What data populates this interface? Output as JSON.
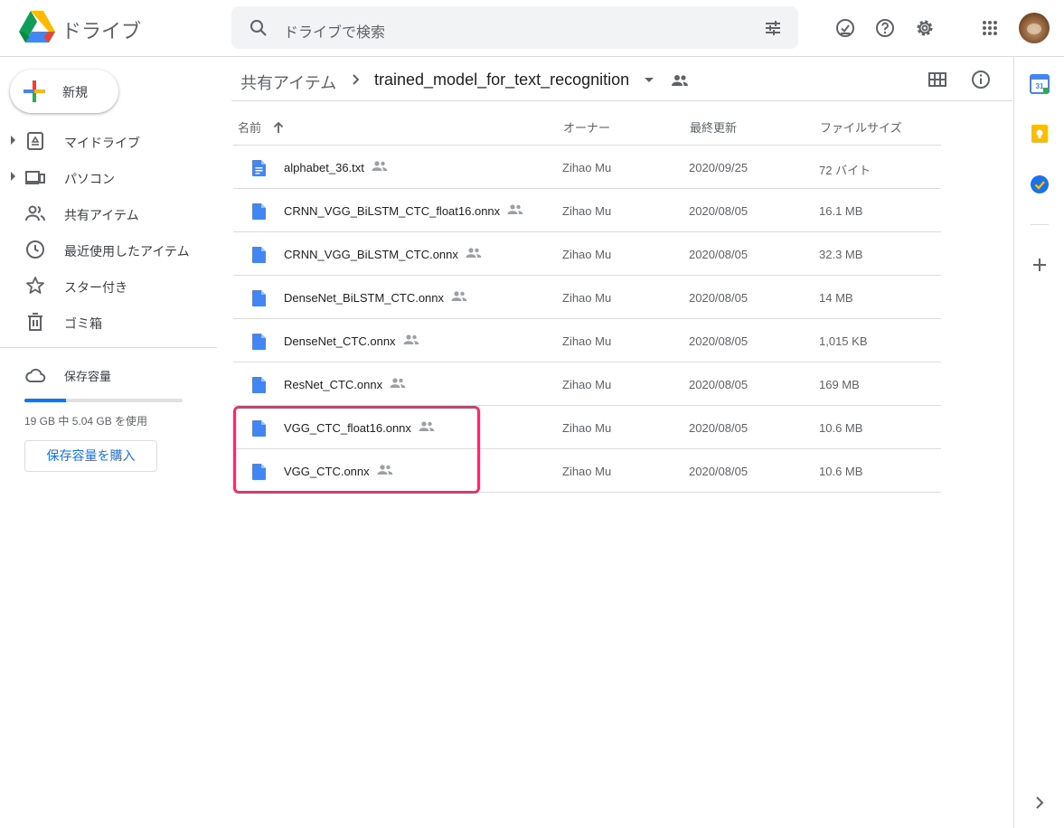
{
  "header": {
    "app_name": "ドライブ",
    "search_placeholder": "ドライブで検索"
  },
  "sidebar": {
    "new_label": "新規",
    "items": [
      {
        "label": "マイドライブ",
        "icon": "my-drive-icon",
        "expandable": true
      },
      {
        "label": "パソコン",
        "icon": "computers-icon",
        "expandable": true
      },
      {
        "label": "共有アイテム",
        "icon": "shared-with-me-icon",
        "expandable": false
      },
      {
        "label": "最近使用したアイテム",
        "icon": "recent-icon",
        "expandable": false
      },
      {
        "label": "スター付き",
        "icon": "star-icon",
        "expandable": false
      },
      {
        "label": "ゴミ箱",
        "icon": "trash-icon",
        "expandable": false
      }
    ],
    "storage": {
      "title": "保存容量",
      "used_text": "19 GB 中 5.04 GB を使用",
      "used_fraction": 0.265,
      "buy_label": "保存容量を購入"
    }
  },
  "breadcrumb": {
    "parent": "共有アイテム",
    "current": "trained_model_for_text_recognition"
  },
  "table": {
    "headers": {
      "name": "名前",
      "owner": "オーナー",
      "modified": "最終更新",
      "size": "ファイルサイズ"
    },
    "rows": [
      {
        "name": "alphabet_36.txt",
        "type": "text",
        "owner": "Zihao Mu",
        "modified": "2020/09/25",
        "size": "72 バイト"
      },
      {
        "name": "CRNN_VGG_BiLSTM_CTC_float16.onnx",
        "type": "file",
        "owner": "Zihao Mu",
        "modified": "2020/08/05",
        "size": "16.1 MB"
      },
      {
        "name": "CRNN_VGG_BiLSTM_CTC.onnx",
        "type": "file",
        "owner": "Zihao Mu",
        "modified": "2020/08/05",
        "size": "32.3 MB"
      },
      {
        "name": "DenseNet_BiLSTM_CTC.onnx",
        "type": "file",
        "owner": "Zihao Mu",
        "modified": "2020/08/05",
        "size": "14 MB"
      },
      {
        "name": "DenseNet_CTC.onnx",
        "type": "file",
        "owner": "Zihao Mu",
        "modified": "2020/08/05",
        "size": "1,015 KB"
      },
      {
        "name": "ResNet_CTC.onnx",
        "type": "file",
        "owner": "Zihao Mu",
        "modified": "2020/08/05",
        "size": "169 MB"
      },
      {
        "name": "VGG_CTC_float16.onnx",
        "type": "file",
        "owner": "Zihao Mu",
        "modified": "2020/08/05",
        "size": "10.6 MB"
      },
      {
        "name": "VGG_CTC.onnx",
        "type": "file",
        "owner": "Zihao Mu",
        "modified": "2020/08/05",
        "size": "10.6 MB"
      }
    ]
  },
  "colors": {
    "accent": "#1a73e8",
    "highlight": "#e8326a"
  }
}
